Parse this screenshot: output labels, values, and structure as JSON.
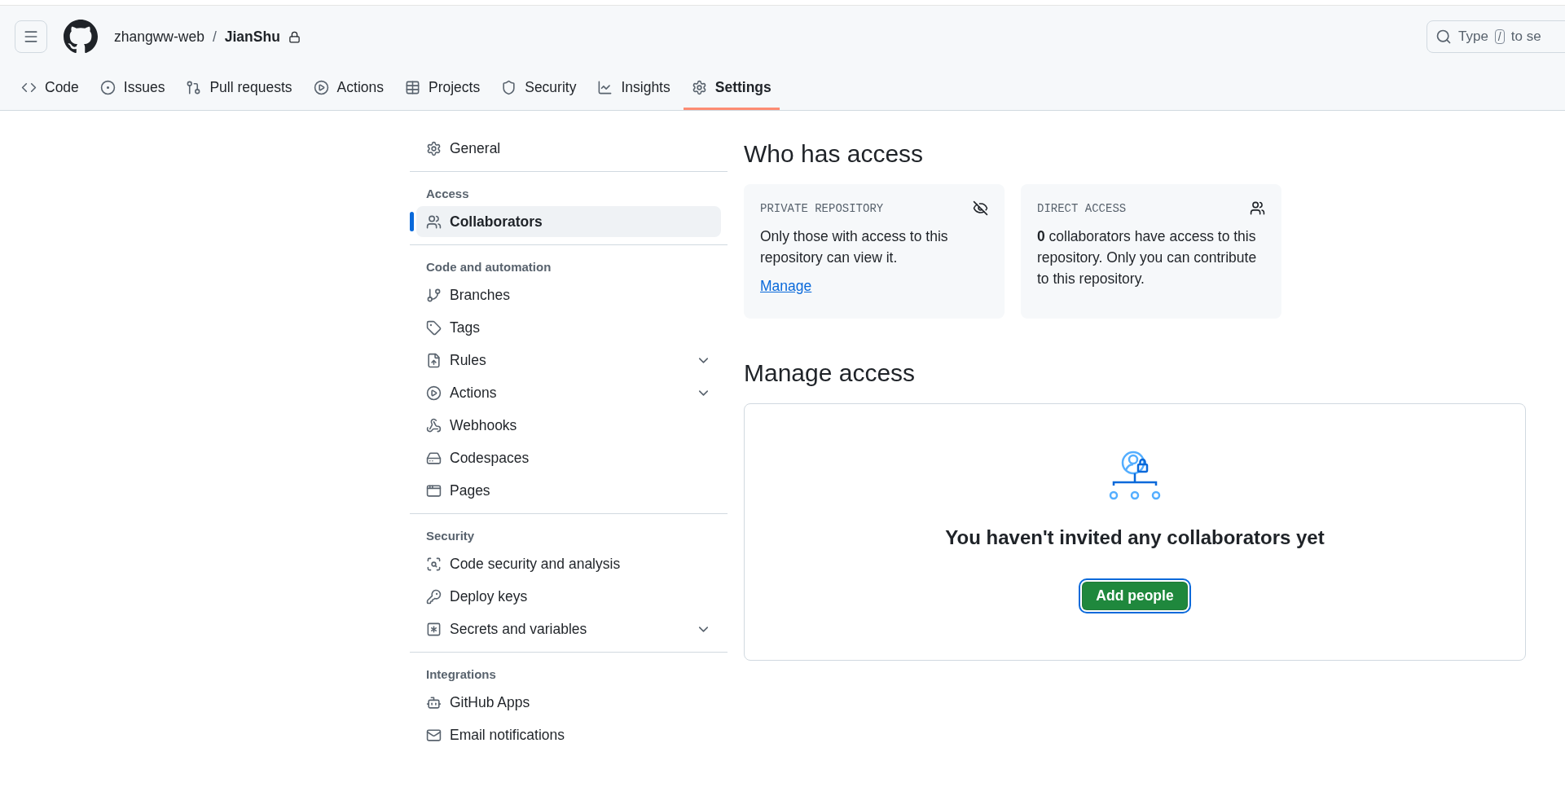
{
  "header": {
    "owner": "zhangww-web",
    "separator": "/",
    "repo": "JianShu",
    "private": true,
    "search": {
      "before": "Type",
      "key": "/",
      "after": "to se"
    }
  },
  "tabs": [
    {
      "label": "Code",
      "selected": false
    },
    {
      "label": "Issues",
      "selected": false
    },
    {
      "label": "Pull requests",
      "selected": false
    },
    {
      "label": "Actions",
      "selected": false
    },
    {
      "label": "Projects",
      "selected": false
    },
    {
      "label": "Security",
      "selected": false
    },
    {
      "label": "Insights",
      "selected": false
    },
    {
      "label": "Settings",
      "selected": true
    }
  ],
  "sidebar": {
    "sections": [
      {
        "items": [
          {
            "label": "General",
            "selected": false,
            "expandable": false
          }
        ]
      },
      {
        "heading": "Access",
        "items": [
          {
            "label": "Collaborators",
            "selected": true,
            "expandable": false
          }
        ]
      },
      {
        "heading": "Code and automation",
        "items": [
          {
            "label": "Branches",
            "selected": false,
            "expandable": false
          },
          {
            "label": "Tags",
            "selected": false,
            "expandable": false
          },
          {
            "label": "Rules",
            "selected": false,
            "expandable": true
          },
          {
            "label": "Actions",
            "selected": false,
            "expandable": true
          },
          {
            "label": "Webhooks",
            "selected": false,
            "expandable": false
          },
          {
            "label": "Codespaces",
            "selected": false,
            "expandable": false
          },
          {
            "label": "Pages",
            "selected": false,
            "expandable": false
          }
        ]
      },
      {
        "heading": "Security",
        "items": [
          {
            "label": "Code security and analysis",
            "selected": false,
            "expandable": false
          },
          {
            "label": "Deploy keys",
            "selected": false,
            "expandable": false
          },
          {
            "label": "Secrets and variables",
            "selected": false,
            "expandable": true
          }
        ]
      },
      {
        "heading": "Integrations",
        "items": [
          {
            "label": "GitHub Apps",
            "selected": false,
            "expandable": false
          },
          {
            "label": "Email notifications",
            "selected": false,
            "expandable": false
          }
        ]
      }
    ]
  },
  "who_has_access": {
    "title": "Who has access",
    "cards": [
      {
        "label": "PRIVATE REPOSITORY",
        "text": "Only those with access to this repository can view it.",
        "link": "Manage"
      },
      {
        "label": "DIRECT ACCESS",
        "text": "**0** collaborators have access to this repository. Only you can contribute to this repository."
      }
    ]
  },
  "manage_access": {
    "title": "Manage access",
    "empty_message": "You haven't invited any collaborators yet",
    "button": "Add people"
  }
}
